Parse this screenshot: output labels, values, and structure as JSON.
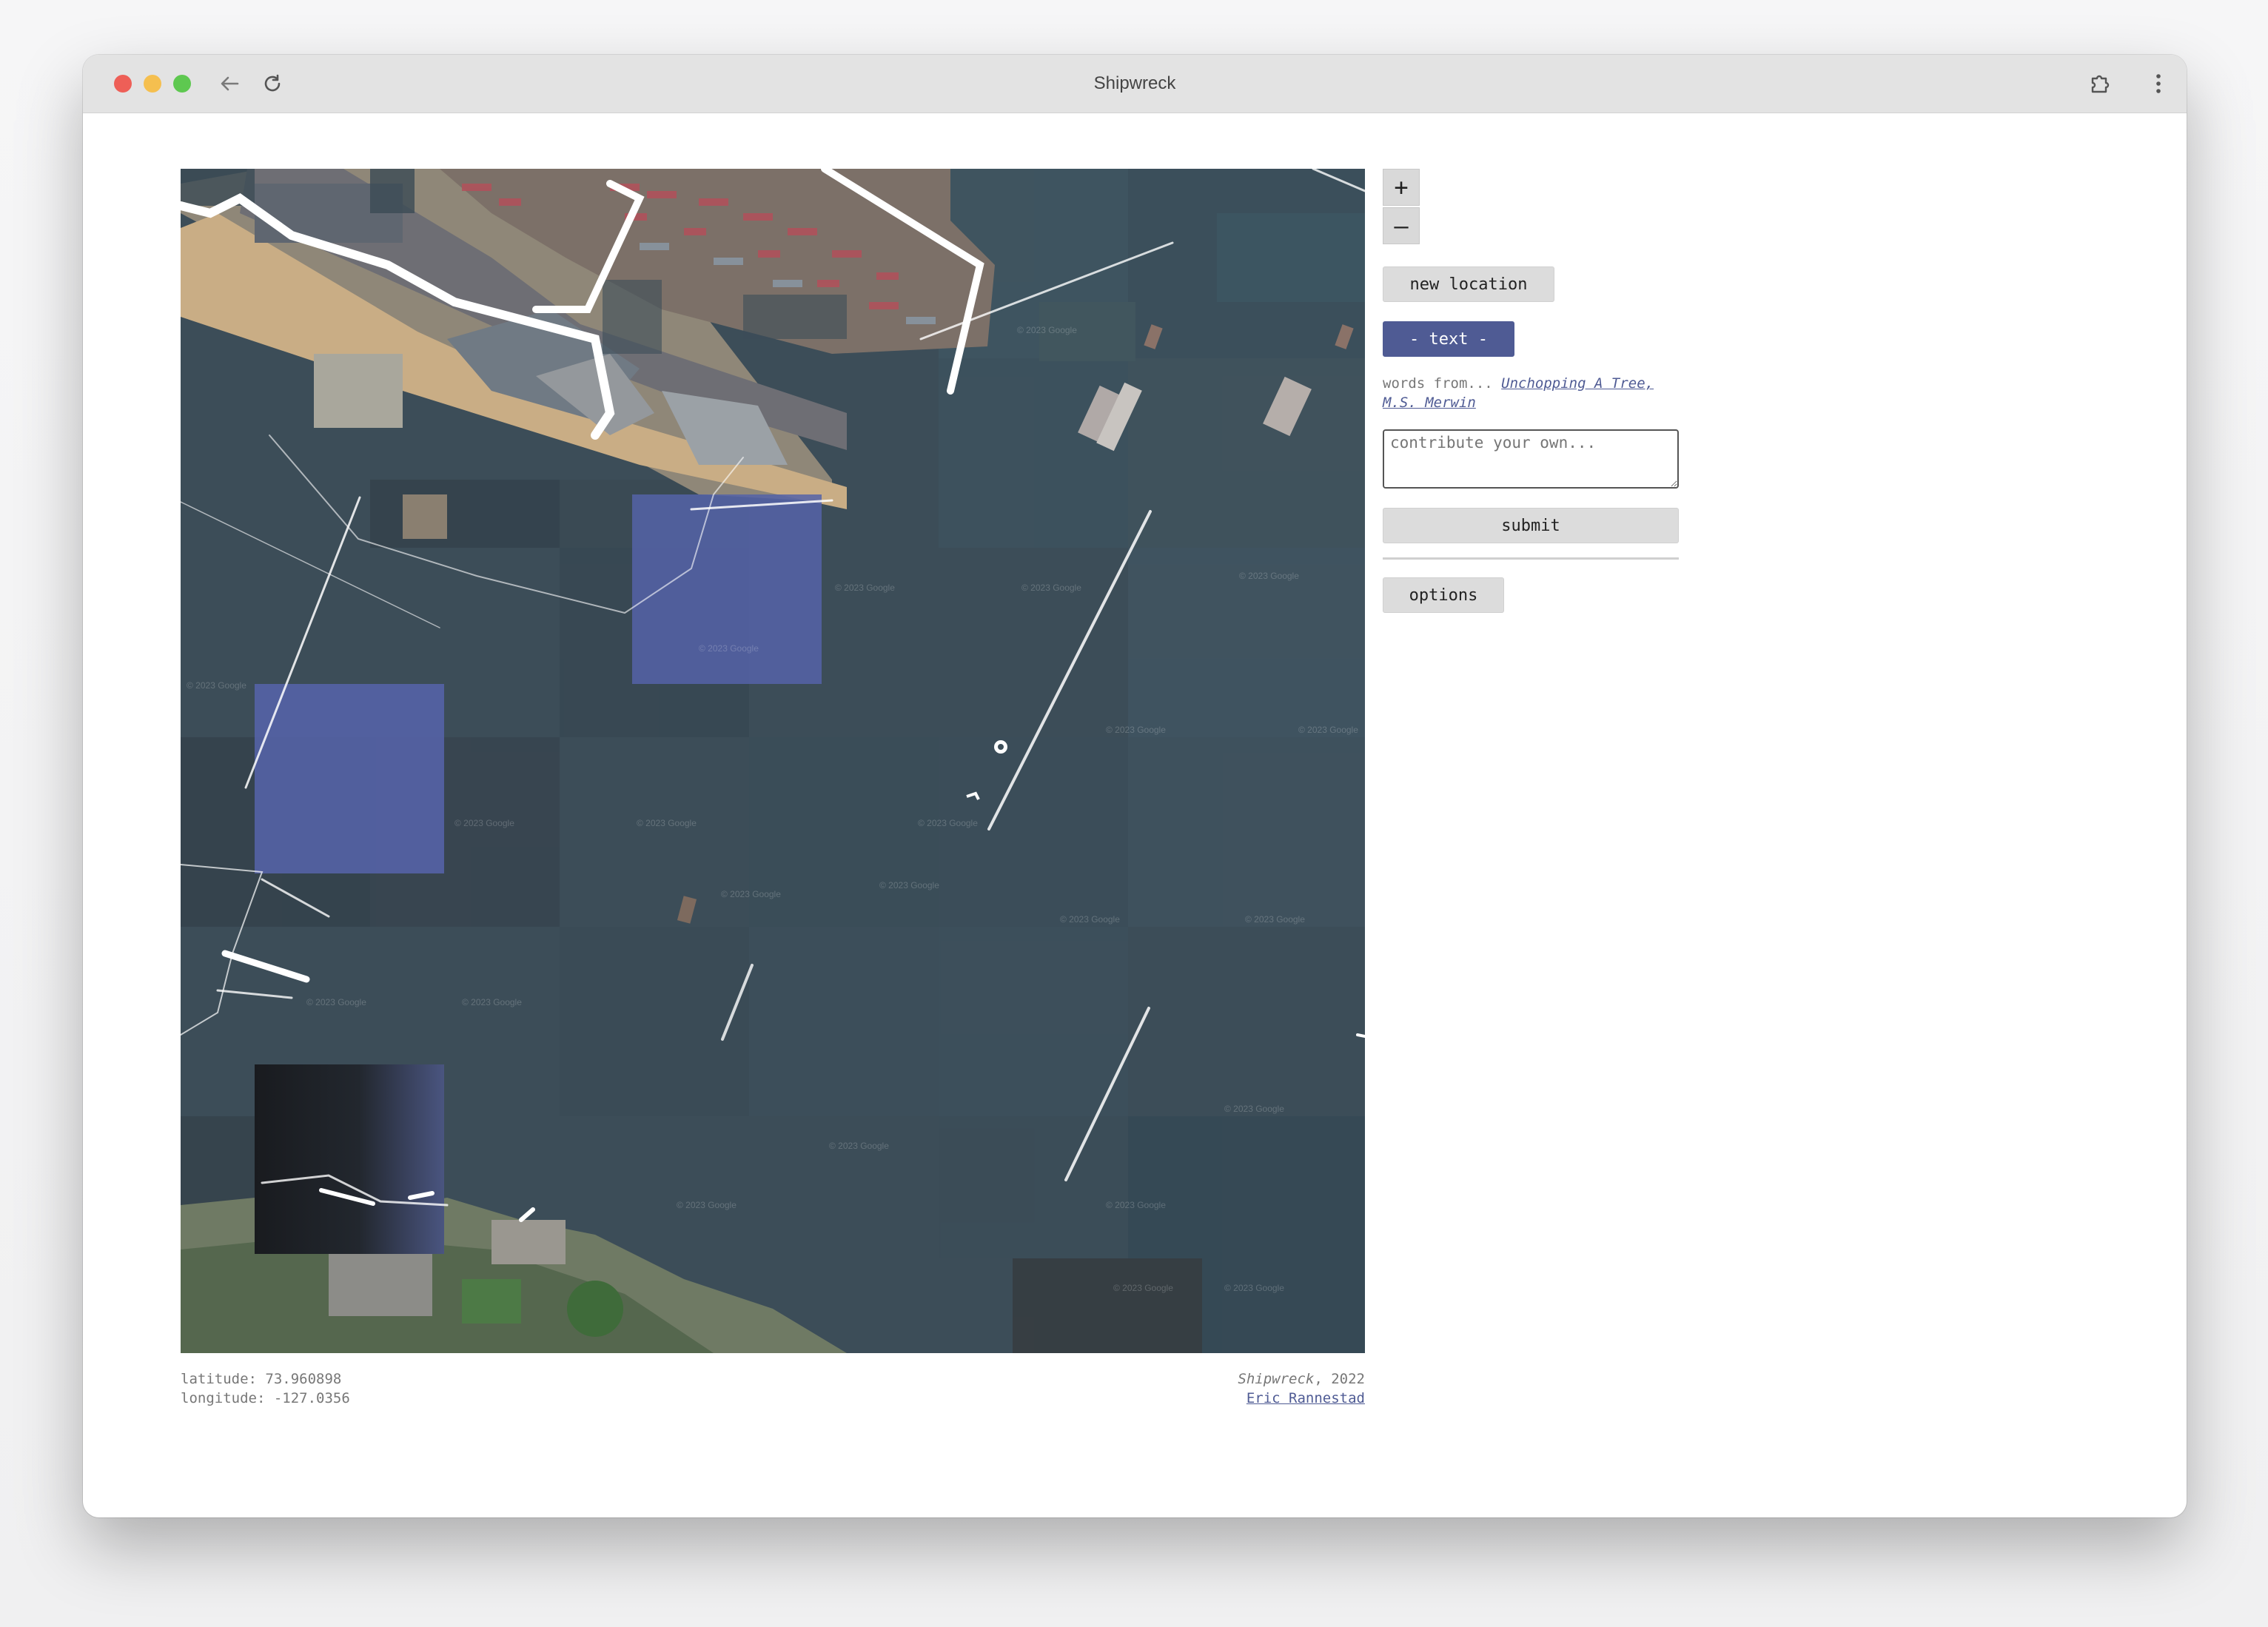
{
  "window": {
    "title": "Shipwreck"
  },
  "browser": {
    "back_icon": "back-arrow-icon",
    "reload_icon": "reload-icon",
    "extensions_icon": "puzzle-icon",
    "menu_icon": "kebab-menu-icon"
  },
  "map": {
    "tile_watermark": "© 2023 Google",
    "overlay_color": "#5563a8"
  },
  "controls": {
    "zoom_in": "+",
    "zoom_out": "–",
    "new_location": "new location",
    "text_toggle": "- text -",
    "credit_prefix": "words from...",
    "credit_work": "Unchopping A Tree,",
    "credit_author": "M.S. Merwin",
    "textarea_placeholder": "contribute your own...",
    "submit": "submit",
    "options": "options"
  },
  "coordinates": {
    "latitude_label": "latitude: 73.960898",
    "longitude_label": "longitude: -127.0356"
  },
  "attribution": {
    "title": "Shipwreck",
    "year": ", 2022",
    "author": "Eric Rannestad"
  },
  "colors": {
    "accent": "#4f5b94",
    "water": "#3c4d58"
  }
}
